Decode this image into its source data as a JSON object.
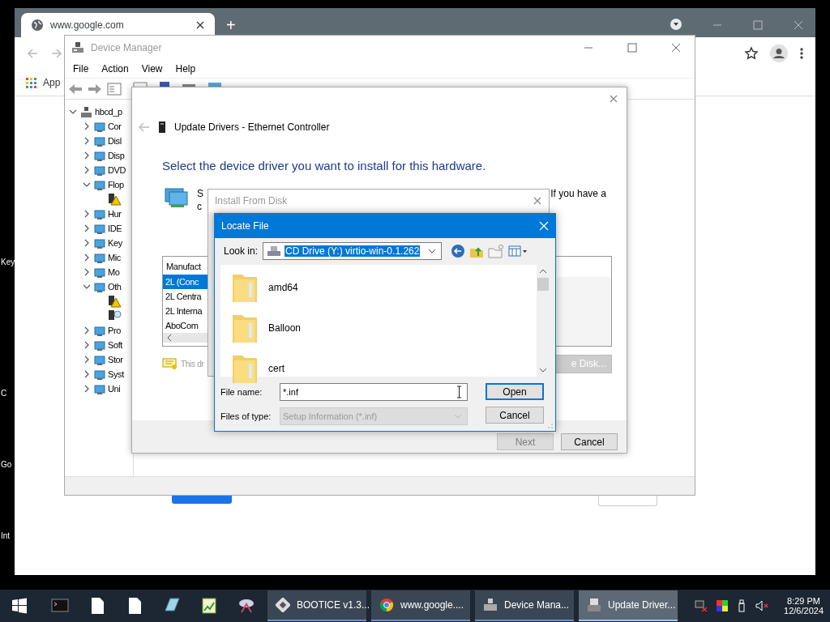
{
  "desktop": {
    "icon_labels": [
      "Key",
      "C",
      "Go",
      "Int"
    ]
  },
  "browser": {
    "tabs": [
      {
        "title": "www.google.com",
        "selected": true
      }
    ],
    "new_tab": "+",
    "bookmarks": [
      "App"
    ]
  },
  "device_manager": {
    "title": "Device Manager",
    "menu": [
      "File",
      "Action",
      "View",
      "Help"
    ],
    "tree": [
      {
        "label": "hbcd_p",
        "expanded": true,
        "children": [
          {
            "label": "Cor",
            "expanded": false
          },
          {
            "label": "Disl",
            "expanded": false
          },
          {
            "label": "Disp",
            "expanded": false
          },
          {
            "label": "DVD",
            "expanded": false
          },
          {
            "label": "Flop",
            "expanded": true,
            "children": [
              {
                "warning": true
              }
            ]
          },
          {
            "label": "Hur",
            "expanded": false
          },
          {
            "label": "IDE",
            "expanded": false
          },
          {
            "label": "Key",
            "expanded": false
          },
          {
            "label": "Mic",
            "expanded": false
          },
          {
            "label": "Mo",
            "expanded": false
          },
          {
            "label": "Oth",
            "expanded": true,
            "children": [
              {
                "warning": true
              },
              {
                "warning": false
              }
            ]
          },
          {
            "label": "Pro",
            "expanded": false
          },
          {
            "label": "Soft",
            "expanded": false
          },
          {
            "label": "Stor",
            "expanded": false
          },
          {
            "label": "Syst",
            "expanded": false
          },
          {
            "label": "Uni",
            "expanded": false
          }
        ]
      }
    ]
  },
  "update_wizard": {
    "title": "Update Drivers - Ethernet Controller",
    "heading": "Select the device driver you want to install for this hardware.",
    "description_fragments": [
      "S",
      "If you have a",
      "c"
    ],
    "manufacturer_list": {
      "header": "Manufact",
      "items": [
        {
          "label": "2L (Conc",
          "selected": true
        },
        {
          "label": "2L Centra",
          "selected": false
        },
        {
          "label": "2L Interna",
          "selected": false
        },
        {
          "label": "AboCom",
          "selected": false
        }
      ]
    },
    "signature_note": "This dr",
    "have_disk_button": "e Disk...",
    "buttons": [
      {
        "label": "Next",
        "disabled": true
      },
      {
        "label": "Cancel",
        "disabled": false
      }
    ]
  },
  "install_from_disk": {
    "title": "Install From Disk"
  },
  "locate_file": {
    "title": "Locate File",
    "look_in_label": "Look in:",
    "look_in_value": "CD Drive (Y:) virtio-win-0.1.262",
    "files": [
      {
        "name": "amd64"
      },
      {
        "name": "Balloon"
      },
      {
        "name": "cert"
      }
    ],
    "file_name_label": "File name:",
    "file_name_value": "*.inf",
    "files_of_type_label": "Files of type:",
    "files_of_type_value": "Setup Information (*.inf)",
    "files_of_type_disabled": true,
    "buttons": [
      {
        "label": "Open",
        "default": true
      },
      {
        "label": "Cancel",
        "default": false
      }
    ]
  },
  "taskbar": {
    "tasks": [
      {
        "label": "BOOTICE v1.3...",
        "active": false
      },
      {
        "label": "www.google....",
        "active": false
      },
      {
        "label": "Device Mana...",
        "active": false
      },
      {
        "label": "Update Driver...",
        "active": true
      }
    ],
    "clock": {
      "time": "8:29 PM",
      "date": "12/6/2024"
    }
  }
}
